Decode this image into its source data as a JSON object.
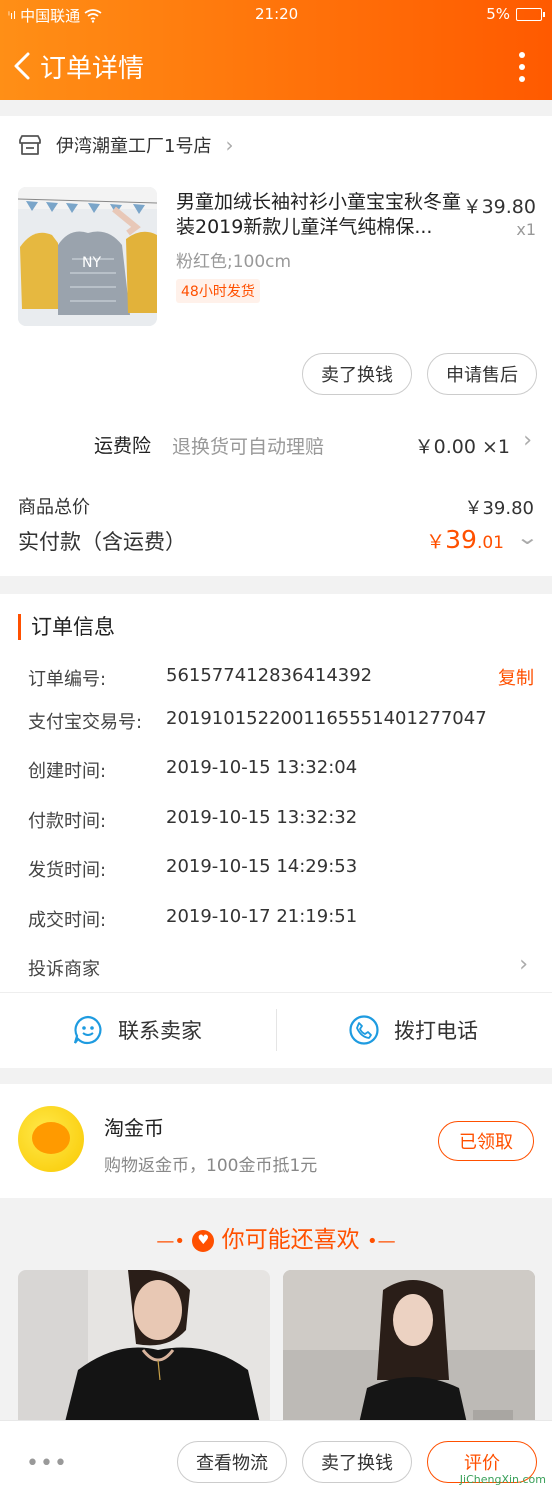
{
  "statusbar": {
    "carrier": "中国联通",
    "time": "21:20",
    "battery": "5%"
  },
  "header": {
    "title": "订单详情"
  },
  "shop": {
    "name": "伊湾潮童工厂1号店"
  },
  "product": {
    "title": "男童加绒长袖衬衫小童宝宝秋冬童装2019新款儿童洋气纯棉保...",
    "price": "￥39.80",
    "qty": "x1",
    "sku": "粉红色;100cm",
    "badge": "48小时发货",
    "btn_sell": "卖了换钱",
    "btn_aftersale": "申请售后"
  },
  "insurance": {
    "label": "运费险",
    "desc": "退换货可自动理赔",
    "value": "￥0.00 ×1"
  },
  "summary": {
    "total_label": "商品总价",
    "total_value": "￥39.80",
    "paid_label": "实付款（含运费）",
    "paid_currency": "￥",
    "paid_int": "39",
    "paid_dec": ".01"
  },
  "order_info": {
    "title": "订单信息",
    "copy": "复制",
    "rows": [
      {
        "label": "订单编号:",
        "value": "561577412836414392"
      },
      {
        "label": "支付宝交易号:",
        "value": "2019101522001165551401277047"
      },
      {
        "label": "创建时间:",
        "value": "2019-10-15 13:32:04"
      },
      {
        "label": "付款时间:",
        "value": "2019-10-15 13:32:32"
      },
      {
        "label": "发货时间:",
        "value": "2019-10-15 14:29:53"
      },
      {
        "label": "成交时间:",
        "value": "2019-10-17 21:19:51"
      }
    ],
    "complain": "投诉商家"
  },
  "contact": {
    "seller": "联系卖家",
    "phone": "拨打电话"
  },
  "coins": {
    "title": "淘金币",
    "desc": "购物返金币，100金币抵1元",
    "button": "已领取"
  },
  "recommend": {
    "title": "你可能还喜欢"
  },
  "bottom": {
    "logistics": "查看物流",
    "sell": "卖了换钱",
    "review": "评价",
    "watermark": "JiChengXin.com"
  },
  "colors": {
    "accent": "#ff5000",
    "header_start": "#ff8f16",
    "header_end": "#ff5a00"
  }
}
